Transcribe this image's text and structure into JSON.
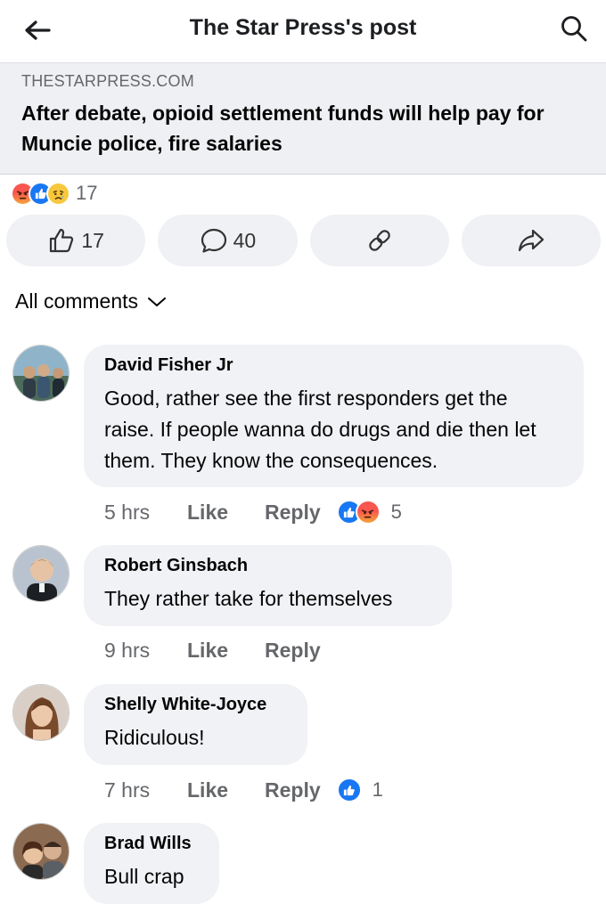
{
  "header": {
    "title": "The Star Press's post"
  },
  "link_preview": {
    "domain": "THESTARPRESS.COM",
    "headline": "After debate, opioid settlement funds will help pay for Muncie police, fire salaries"
  },
  "reactions": {
    "icons": [
      "angry-icon",
      "like-icon",
      "sad-icon"
    ],
    "count": "17"
  },
  "actions": {
    "likes": "17",
    "comments": "40"
  },
  "comments_filter": {
    "label": "All comments"
  },
  "comments": [
    {
      "author": "David Fisher Jr",
      "text": "Good, rather see the first responders get the raise. If people wanna do drugs and die then let them. They know the consequences.",
      "time": "5 hrs",
      "like_label": "Like",
      "reply_label": "Reply",
      "reactions": [
        "like-icon",
        "angry-icon"
      ],
      "reaction_count": "5"
    },
    {
      "author": "Robert Ginsbach",
      "text": "They rather take for themselves",
      "time": "9 hrs",
      "like_label": "Like",
      "reply_label": "Reply"
    },
    {
      "author": "Shelly White-Joyce",
      "text": "Ridiculous!",
      "time": "7 hrs",
      "like_label": "Like",
      "reply_label": "Reply",
      "reactions": [
        "like-icon"
      ],
      "reaction_count": "1"
    },
    {
      "author": "Brad Wills",
      "text": "Bull crap"
    }
  ],
  "colors": {
    "like_blue": "#1877f2",
    "bubble_gray": "#f0f2f5",
    "meta_gray": "#65676b"
  }
}
